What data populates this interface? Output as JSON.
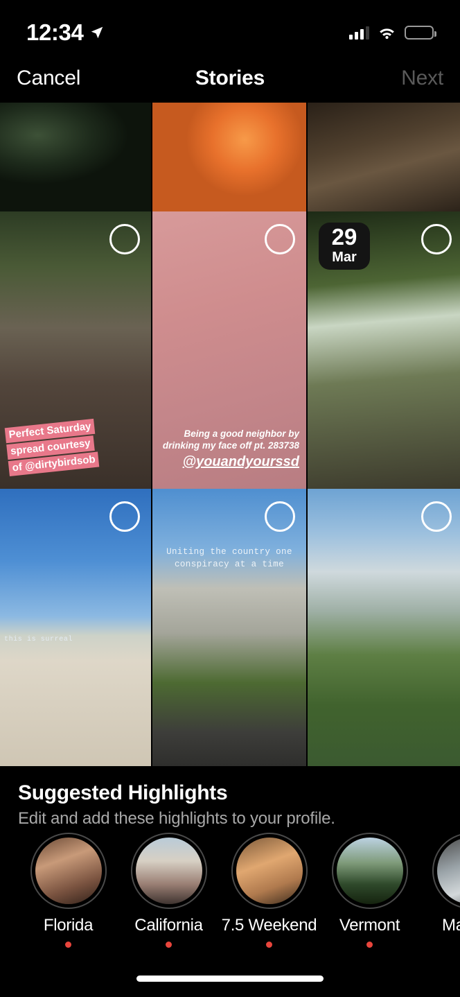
{
  "status_bar": {
    "time": "12:34",
    "location_icon": "location-arrow-icon",
    "cell_icon": "cellular-signal-icon",
    "wifi_icon": "wifi-icon",
    "battery_icon": "battery-icon",
    "battery_color": "#f7cf22"
  },
  "nav": {
    "cancel_label": "Cancel",
    "title": "Stories",
    "next_label": "Next",
    "next_color": "#5a5a5a"
  },
  "grid": {
    "tiles": [
      {
        "id": "tile-r1c1",
        "alt": "succulent-plants",
        "selectable": false,
        "date": null,
        "caption": null
      },
      {
        "id": "tile-r1c2",
        "alt": "hand-holding-orange-drink",
        "selectable": false,
        "date": null,
        "caption": null
      },
      {
        "id": "tile-r1c3",
        "alt": "desk-with-laptop-and-drinks",
        "selectable": false,
        "date": null,
        "caption": null
      },
      {
        "id": "tile-r2c1",
        "alt": "patio-takeout-wings",
        "selectable": true,
        "caption_lines": [
          "Perfect Saturday",
          "spread courtesy",
          "of @dirtybirdsob"
        ],
        "caption_style": "pink-highlight",
        "caption_color": "#e8788a"
      },
      {
        "id": "tile-r2c2",
        "alt": "gin-and-tonic-can",
        "selectable": true,
        "caption_lines": [
          "Being a good neighbor by",
          "drinking my face off pt. 283738"
        ],
        "caption_handle": "@youandyourssd",
        "caption_style": "white-italic"
      },
      {
        "id": "tile-r2c3",
        "alt": "backyard-patio-seating",
        "selectable": true,
        "date_day": "29",
        "date_month": "Mar"
      },
      {
        "id": "tile-r3c1",
        "alt": "beach-and-pier",
        "selectable": true,
        "caption_lines": [
          "this is surreal"
        ],
        "caption_style": "mono-small"
      },
      {
        "id": "tile-r3c2",
        "alt": "boarded-up-house-with-banner",
        "selectable": true,
        "caption_lines": [
          "Uniting the country one",
          "conspiracy at a time"
        ],
        "caption_style": "mono-center"
      },
      {
        "id": "tile-r3c3",
        "alt": "coastal-cliff-house",
        "selectable": true,
        "caption": null
      }
    ]
  },
  "suggested": {
    "title": "Suggested Highlights",
    "subtitle": "Edit and add these highlights to your profile.",
    "items": [
      {
        "label": "Florida",
        "has_dot": true,
        "dot_color": "#e8453c",
        "thumb": "group-photo-indoors"
      },
      {
        "label": "California",
        "has_dot": true,
        "dot_color": "#e8453c",
        "thumb": "group-photo-outdoors"
      },
      {
        "label": "7.5 Weekend",
        "has_dot": true,
        "dot_color": "#e8453c",
        "thumb": "person-on-couch"
      },
      {
        "label": "Vermont",
        "has_dot": true,
        "dot_color": "#e8453c",
        "thumb": "forest-road"
      },
      {
        "label": "Massac",
        "has_dot": true,
        "dot_color": "#e8453c",
        "thumb": "kitchen-scene"
      }
    ]
  },
  "home_indicator": "home-indicator"
}
